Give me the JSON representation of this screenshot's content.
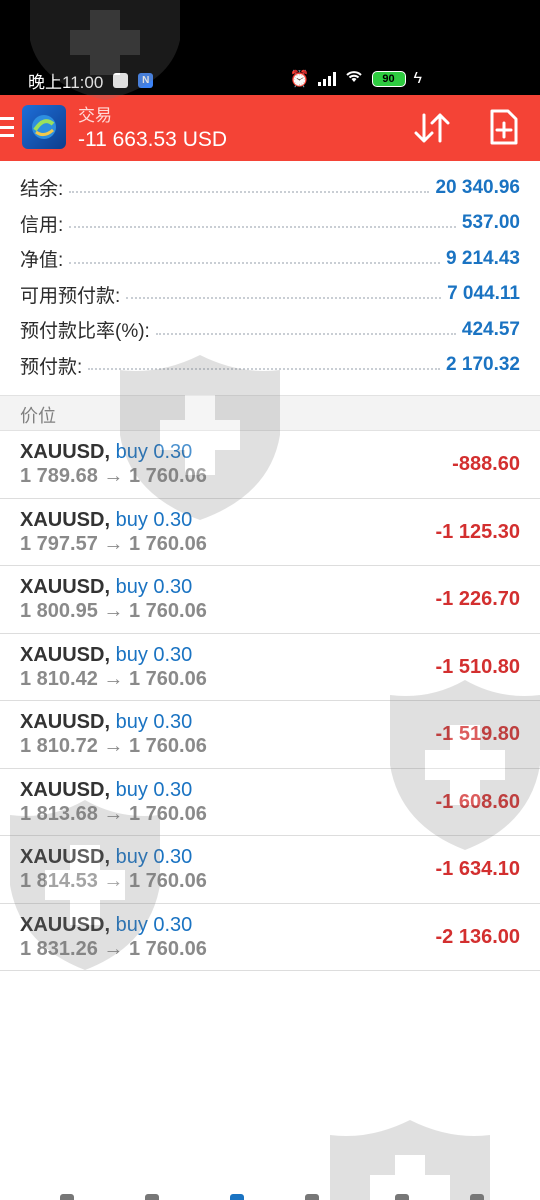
{
  "status_bar": {
    "time": "晚上11:00",
    "battery": "90",
    "icons": [
      "phone-app-icon",
      "notification-n-icon",
      "alarm-icon",
      "signal-icon",
      "wifi-icon",
      "battery-icon",
      "charging-icon"
    ]
  },
  "app_bar": {
    "subtitle": "交易",
    "title": "-11 663.53 USD",
    "accent_color": "#f44336",
    "icons": [
      "menu-icon",
      "app-logo",
      "sort-icon",
      "new-order-icon"
    ]
  },
  "summary": {
    "rows": [
      {
        "label": "结余:",
        "value": "20 340.96"
      },
      {
        "label": "信用:",
        "value": "537.00"
      },
      {
        "label": "净值:",
        "value": "9 214.43"
      },
      {
        "label": "可用预付款:",
        "value": "7 044.11"
      },
      {
        "label": "预付款比率(%):",
        "value": "424.57"
      },
      {
        "label": "预付款:",
        "value": "2 170.32"
      }
    ],
    "value_color": "#1a73c2"
  },
  "section": {
    "label": "价位"
  },
  "positions": [
    {
      "symbol": "XAUUSD",
      "sep": ",",
      "side": "buy 0.30",
      "prices": "1 789.68 → 1 760.06",
      "profit": "-888.60"
    },
    {
      "symbol": "XAUUSD",
      "sep": ",",
      "side": "buy 0.30",
      "prices": "1 797.57 → 1 760.06",
      "profit": "-1 125.30"
    },
    {
      "symbol": "XAUUSD",
      "sep": ",",
      "side": "buy 0.30",
      "prices": "1 800.95 → 1 760.06",
      "profit": "-1 226.70"
    },
    {
      "symbol": "XAUUSD",
      "sep": ",",
      "side": "buy 0.30",
      "prices": "1 810.42 → 1 760.06",
      "profit": "-1 510.80"
    },
    {
      "symbol": "XAUUSD",
      "sep": ",",
      "side": "buy 0.30",
      "prices": "1 810.72 → 1 760.06",
      "profit": "-1 519.80"
    },
    {
      "symbol": "XAUUSD",
      "sep": ",",
      "side": "buy 0.30",
      "prices": "1 813.68 → 1 760.06",
      "profit": "-1 608.60"
    },
    {
      "symbol": "XAUUSD",
      "sep": ",",
      "side": "buy 0.30",
      "prices": "1 814.53 → 1 760.06",
      "profit": "-1 634.10"
    },
    {
      "symbol": "XAUUSD",
      "sep": ",",
      "side": "buy 0.30",
      "prices": "1 831.26 → 1 760.06",
      "profit": "-2 136.00"
    }
  ],
  "colors": {
    "loss": "#d32f2f",
    "buy": "#1a73c2"
  }
}
